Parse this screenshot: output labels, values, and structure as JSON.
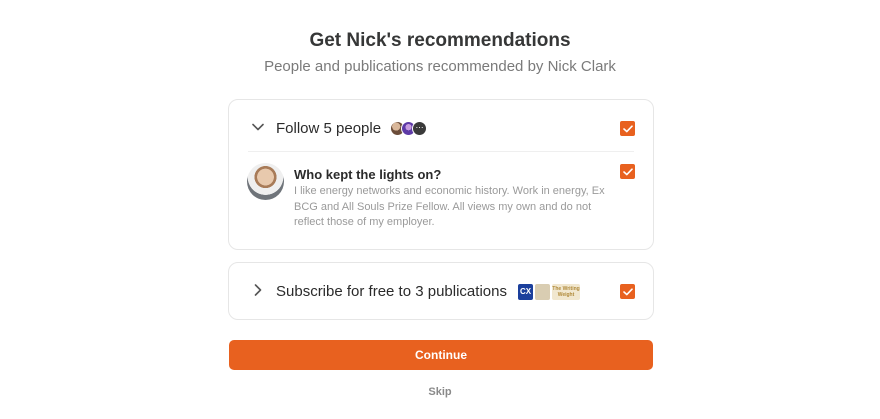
{
  "header": {
    "title": "Get Nick's recommendations",
    "subtitle": "People and publications recommended by Nick Clark"
  },
  "people_section": {
    "label": "Follow 5 people",
    "expanded": true,
    "checked": true,
    "avatar_overflow": "⋯",
    "person": {
      "name": "Who kept the lights on?",
      "bio": "I like energy networks and economic history. Work in energy, Ex BCG and All Souls Prize Fellow. All views my own and do not reflect those of my employer.",
      "checked": true
    }
  },
  "publications_section": {
    "label": "Subscribe for free to 3 publications",
    "expanded": false,
    "checked": true,
    "logos": [
      "CX",
      "",
      "The Writing Weight"
    ]
  },
  "actions": {
    "continue_label": "Continue",
    "skip_label": "Skip"
  },
  "colors": {
    "accent": "#e8611f",
    "title": "#363737",
    "muted": "#7a7a7a"
  }
}
